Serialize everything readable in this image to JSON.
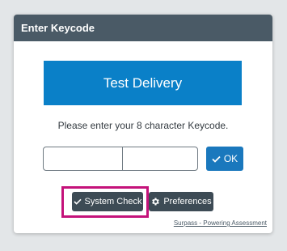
{
  "dialog": {
    "title": "Enter Keycode",
    "banner_text": "Test Delivery",
    "prompt": "Please enter your 8 character Keycode.",
    "keycode": {
      "part1_value": "",
      "part2_value": "",
      "part1_placeholder": "",
      "part2_placeholder": ""
    },
    "ok_label": "OK",
    "system_check_label": "System Check",
    "preferences_label": "Preferences",
    "footer_link": "Surpass - Powering Assessment"
  },
  "icons": {
    "ok": "check-icon",
    "system_check": "check-icon",
    "preferences": "gear-icon"
  },
  "colors": {
    "header_bg": "#4a5a66",
    "banner_bg": "#0a80c8",
    "ok_bg": "#1a78bd",
    "dark_button_bg": "#3d4b55",
    "highlight": "#c4127a"
  }
}
